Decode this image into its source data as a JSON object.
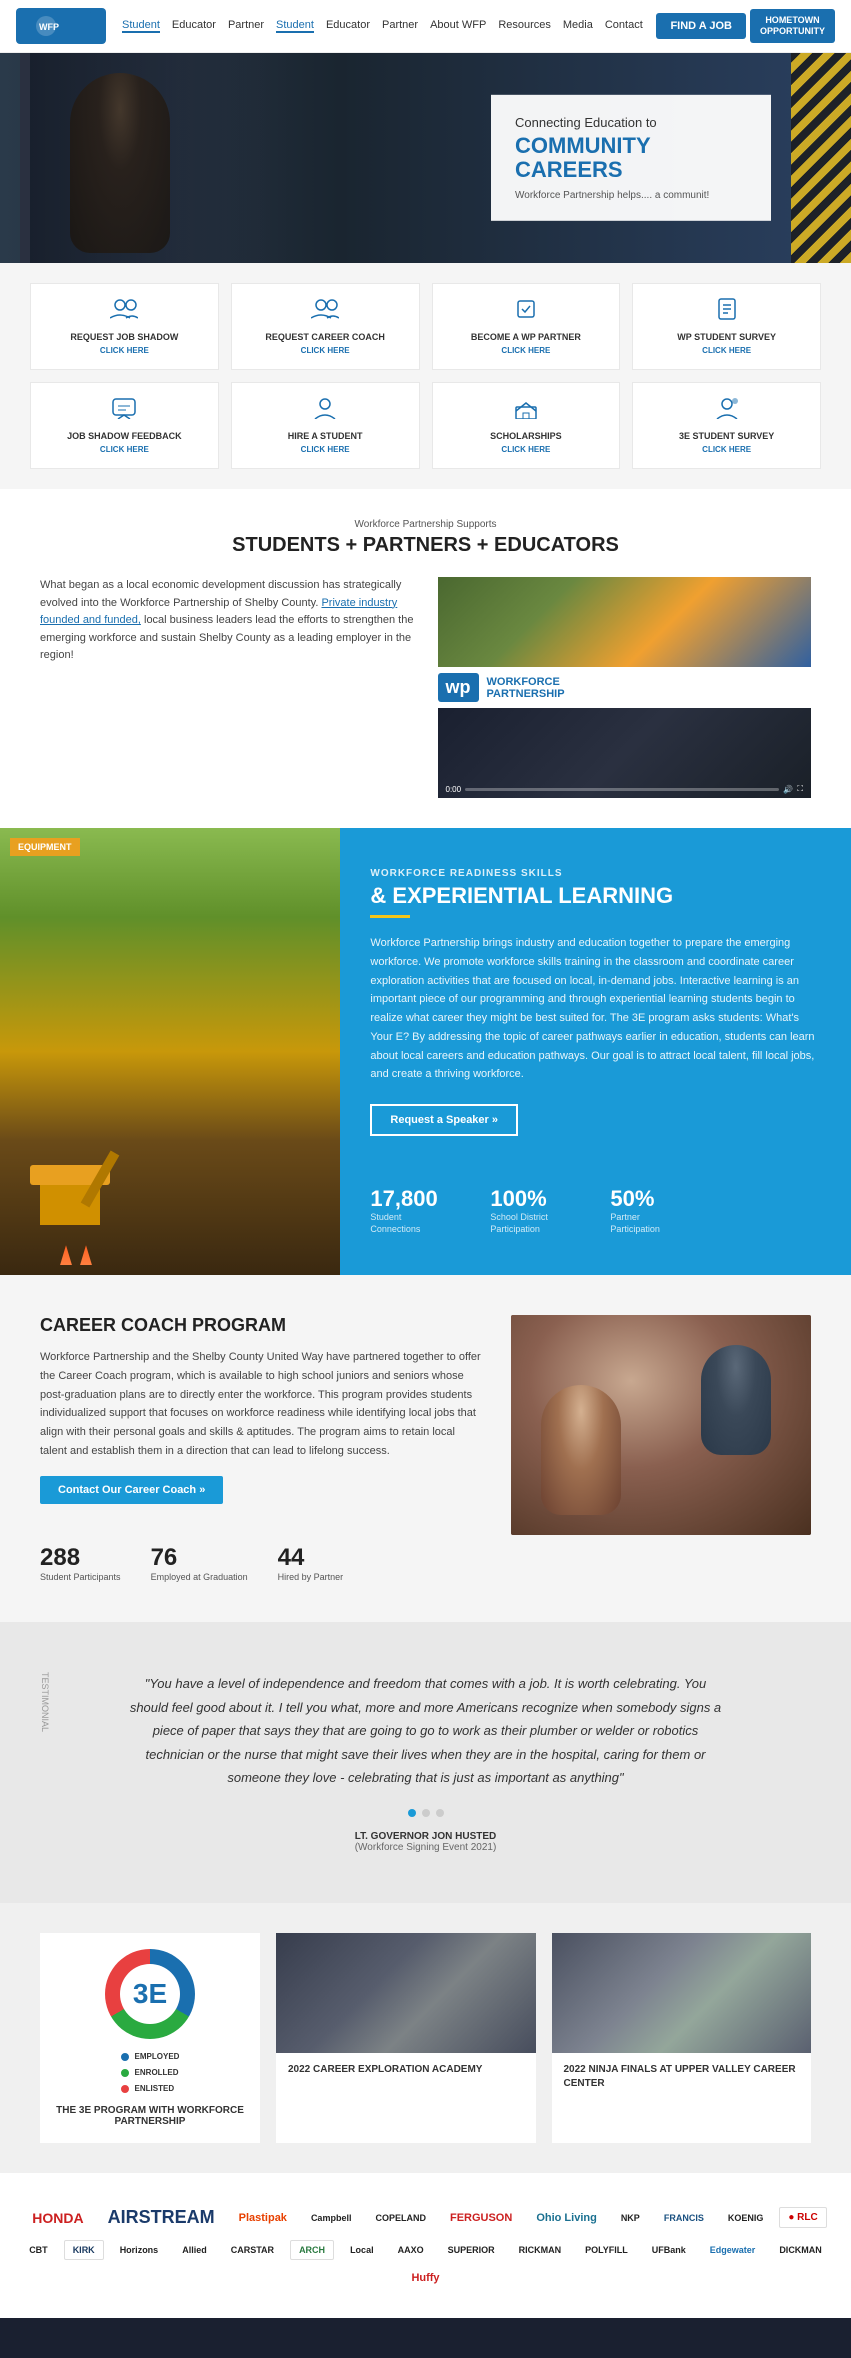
{
  "navbar": {
    "logo": "WP",
    "links": [
      {
        "label": "Student",
        "active": true
      },
      {
        "label": "Educator",
        "active": false
      },
      {
        "label": "Partner",
        "active": false
      },
      {
        "label": "Student",
        "active": false
      },
      {
        "label": "Educator",
        "active": false
      },
      {
        "label": "Partner",
        "active": false
      },
      {
        "label": "About WFP",
        "active": false
      },
      {
        "label": "Resources",
        "active": false
      },
      {
        "label": "Media",
        "active": false
      },
      {
        "label": "Contact",
        "active": false
      }
    ],
    "find_job_btn": "FIND A JOB",
    "badge_line1": "HOMETOWN",
    "badge_line2": "OPPORTUNITY"
  },
  "hero": {
    "subtitle": "Connecting Education to",
    "title": "COMMUNITY CAREERS",
    "description": "Workforce Partnership helps.... a communit!"
  },
  "quick_links": {
    "row1": [
      {
        "icon": "👤",
        "title": "REQUEST JOB SHADOW",
        "action": "CLICK HERE"
      },
      {
        "icon": "👥",
        "title": "REQUEST CAREER COACH",
        "action": "CLICK HERE"
      },
      {
        "icon": "🤝",
        "title": "BECOME A WP PARTNER",
        "action": "CLICK HERE"
      },
      {
        "icon": "📋",
        "title": "WP STUDENT SURVEY",
        "action": "CLICK HERE"
      }
    ],
    "row2": [
      {
        "icon": "💬",
        "title": "JOB SHADOW FEEDBACK",
        "action": "CLICK HERE"
      },
      {
        "icon": "🎓",
        "title": "HIRE A STUDENT",
        "action": "CLICK HERE"
      },
      {
        "icon": "🏛️",
        "title": "SCHOLARSHIPS",
        "action": "CLICK HERE"
      },
      {
        "icon": "📝",
        "title": "3E STUDENT SURVEY",
        "action": "CLICK HERE"
      }
    ]
  },
  "students_section": {
    "label": "Workforce Partnership Supports",
    "title": "STUDENTS + PARTNERS + EDUCATORS",
    "text": "What began as a local economic development discussion has strategically evolved into the Workforce Partnership of Shelby County. Private industry founded and funded, local business leaders lead the efforts to strengthen the emerging workforce and sustain Shelby County as a leading employer in the region!",
    "link_text": "Private industry founded and funded,"
  },
  "exp_section": {
    "label": "WORKFORCE READINESS SKILLS",
    "title": "& EXPERIENTIAL LEARNING",
    "text": "Workforce Partnership brings industry and education together to prepare the emerging workforce. We promote workforce skills training in the classroom and coordinate career exploration activities that are focused on local, in-demand jobs. Interactive learning is an important piece of our programming and through experiential learning students begin to realize what career they might be best suited for. The 3E program asks students: What's Your E? By addressing the topic of career pathways earlier in education, students can learn about local careers and education pathways. Our goal is to attract local talent, fill local jobs, and create a thriving workforce.",
    "btn": "Request a Speaker »",
    "stats": [
      {
        "number": "17,800",
        "label": "Student Connections"
      },
      {
        "number": "100%",
        "label": "School District Participation"
      },
      {
        "number": "50%",
        "label": "Partner Participation"
      }
    ],
    "equipment_sign": "EQUIPMENT"
  },
  "coach_section": {
    "title": "CAREER COACH PROGRAM",
    "text": "Workforce Partnership and the Shelby County United Way have partnered together to offer the Career Coach program, which is available to high school juniors and seniors whose post-graduation plans are to directly enter the workforce. This program provides students individualized support that focuses on workforce readiness while identifying local jobs that align with their personal goals and skills & aptitudes. The program aims to retain local talent and establish them in a direction that can lead to lifelong success.",
    "btn": "Contact Our Career Coach »",
    "stats": [
      {
        "number": "288",
        "label": "Student Participants"
      },
      {
        "number": "76",
        "label": "Employed at Graduation"
      },
      {
        "number": "44",
        "label": "Hired by Partner"
      }
    ]
  },
  "quote_section": {
    "text": "\"You have a level of independence and freedom that comes with a job. It is worth celebrating. You should feel good about it. I tell you what, more and more Americans recognize when somebody signs a piece of paper that says they that are going to go to work as their plumber or welder or robotics technician or the nurse that might save their lives when they are in the hospital, caring for them or someone they love - celebrating that is just as important as anything\"",
    "author": "LT. GOVERNOR JON HUSTED",
    "role": "(Workforce Signing Event 2021)"
  },
  "three_e_section": {
    "logo_title": "THE 3E PROGRAM WITH WORKFORCE PARTNERSHIP",
    "labels": [
      {
        "color": "#1a6faf",
        "text": "EMPLOYED"
      },
      {
        "color": "#2aaa40",
        "text": "ENROLLED"
      },
      {
        "color": "#e84040",
        "text": "ENLISTED"
      }
    ],
    "number": "3E",
    "cards": [
      {
        "title": "2022 CAREER EXPLORATION ACADEMY",
        "img_style": "linear-gradient(135deg, #2a3040 0%, #5a6070 50%, #3a4050 100%)"
      },
      {
        "title": "2022 NINJA FINALS AT UPPER VALLEY CAREER CENTER",
        "img_style": "linear-gradient(135deg, #3a4050 0%, #6a7080 50%, #4a5060 100%)"
      }
    ]
  },
  "sponsors": {
    "logos": [
      {
        "name": "HONDA",
        "class": "red"
      },
      {
        "name": "AIRSTREAM",
        "class": "dark large"
      },
      {
        "name": "Plastipak",
        "class": "dark"
      },
      {
        "name": "Copeland",
        "class": "dark"
      },
      {
        "name": "FERGUSON",
        "class": "red"
      },
      {
        "name": "Ohio Living",
        "class": "blue"
      },
      {
        "name": "NKF",
        "class": "dark"
      },
      {
        "name": "FRANCIS",
        "class": "dark"
      },
      {
        "name": "KOENIG",
        "class": "dark"
      },
      {
        "name": "CarStar",
        "class": "dark"
      },
      {
        "name": "CBT",
        "class": "dark"
      },
      {
        "name": "KIRK",
        "class": "dark"
      },
      {
        "name": "Allied",
        "class": "dark"
      },
      {
        "name": "Local",
        "class": "dark"
      },
      {
        "name": "CARSTAR",
        "class": "dark"
      },
      {
        "name": "ARCH",
        "class": "dark"
      },
      {
        "name": "SUPERIOR",
        "class": "dark"
      },
      {
        "name": "RICKMAN",
        "class": "dark"
      },
      {
        "name": "POLYFILL",
        "class": "dark"
      },
      {
        "name": "UFBank",
        "class": "dark"
      },
      {
        "name": "Edgewater",
        "class": "dark"
      }
    ]
  }
}
